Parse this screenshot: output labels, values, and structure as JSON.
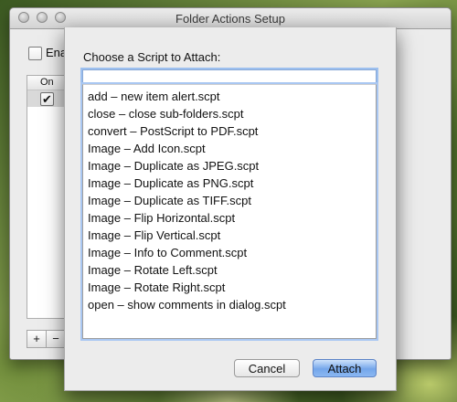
{
  "window": {
    "title": "Folder Actions Setup",
    "enable_label": "Enable Folder Actions",
    "table": {
      "header_on": "On",
      "rows": [
        {
          "checked": true,
          "check_glyph": "✔"
        }
      ]
    },
    "add_button": "+",
    "remove_button": "−"
  },
  "sheet": {
    "title": "Choose a Script to Attach:",
    "search_value": "",
    "scripts": [
      "add – new item alert.scpt",
      "close – close sub-folders.scpt",
      "convert – PostScript to PDF.scpt",
      "Image – Add Icon.scpt",
      "Image – Duplicate as JPEG.scpt",
      "Image – Duplicate as PNG.scpt",
      "Image – Duplicate as TIFF.scpt",
      "Image – Flip Horizontal.scpt",
      "Image – Flip Vertical.scpt",
      "Image – Info to Comment.scpt",
      "Image – Rotate Left.scpt",
      "Image – Rotate Right.scpt",
      "open – show comments in dialog.scpt"
    ],
    "cancel_label": "Cancel",
    "attach_label": "Attach"
  },
  "colors": {
    "accent_focus": "#9dc0ef",
    "default_button": "#74a6ea"
  }
}
